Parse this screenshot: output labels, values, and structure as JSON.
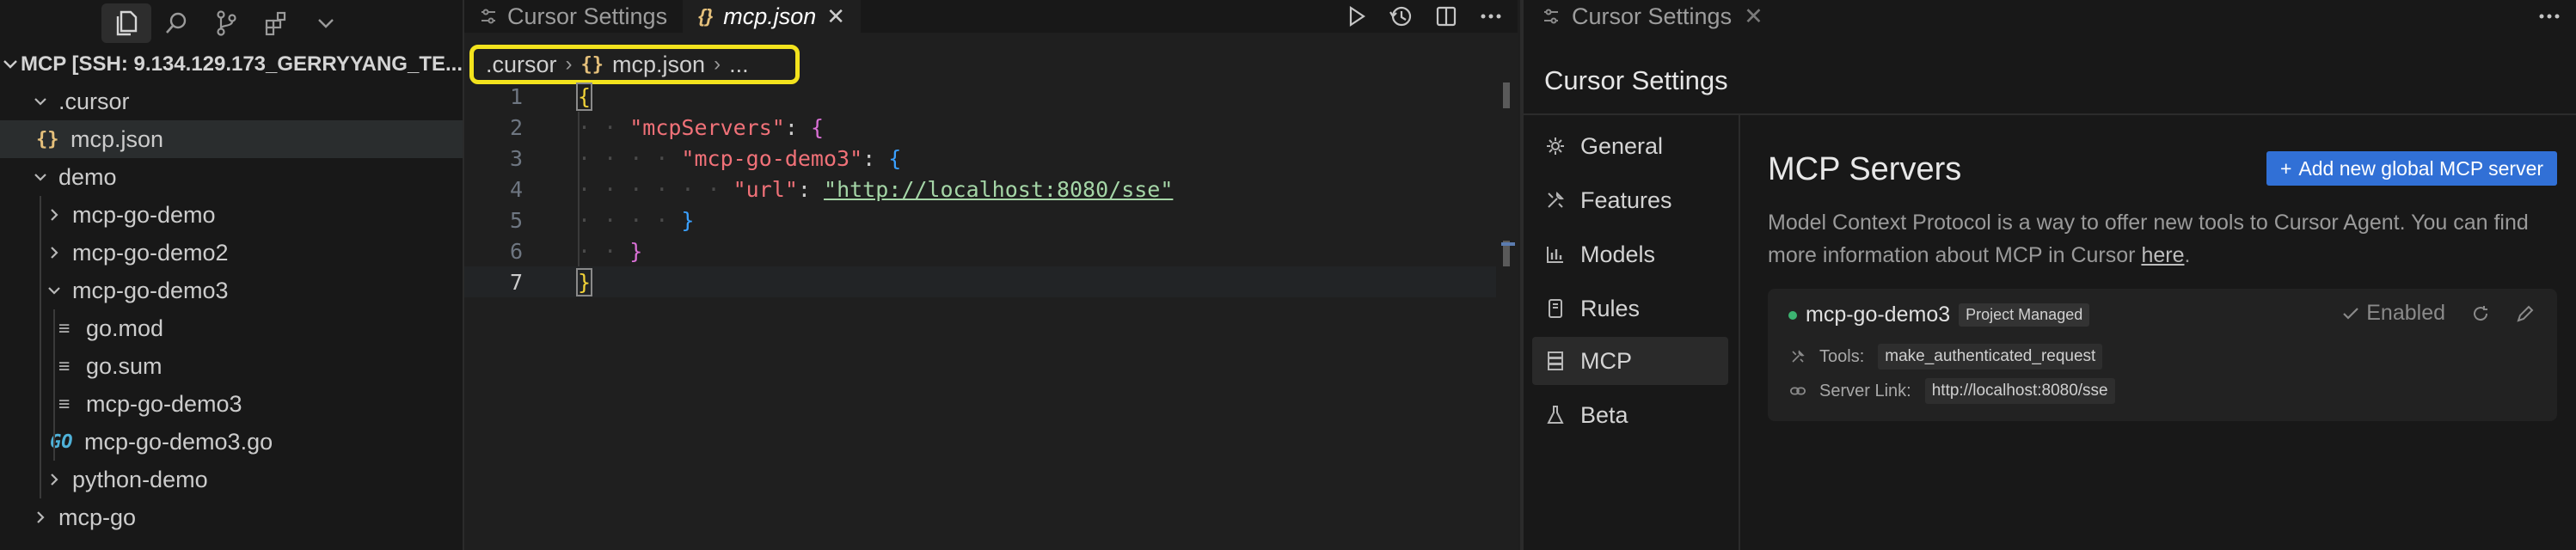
{
  "sidebar": {
    "activity_icons": [
      "files-icon",
      "search-icon",
      "source-control-icon",
      "extensions-icon",
      "chevron-down-icon"
    ],
    "workspace_title": "MCP [SSH: 9.134.129.173_GERRYYANG_TE...",
    "tree": [
      {
        "label": ".cursor",
        "type": "folder",
        "expanded": true
      },
      {
        "label": "mcp.json",
        "type": "json-file",
        "selected": true
      },
      {
        "label": "demo",
        "type": "folder",
        "expanded": true
      },
      {
        "label": "mcp-go-demo",
        "type": "folder",
        "expanded": false
      },
      {
        "label": "mcp-go-demo2",
        "type": "folder",
        "expanded": false
      },
      {
        "label": "mcp-go-demo3",
        "type": "folder",
        "expanded": true
      },
      {
        "label": "go.mod",
        "type": "text-file"
      },
      {
        "label": "go.sum",
        "type": "text-file"
      },
      {
        "label": "mcp-go-demo3",
        "type": "text-file"
      },
      {
        "label": "mcp-go-demo3.go",
        "type": "go-file",
        "icon_text": "GO"
      },
      {
        "label": "python-demo",
        "type": "folder",
        "expanded": false
      },
      {
        "label": "mcp-go",
        "type": "folder",
        "expanded": false
      }
    ]
  },
  "editor": {
    "tabs": [
      {
        "label": "Cursor Settings",
        "icon": "settings-sliders-icon",
        "active": false
      },
      {
        "label": "mcp.json",
        "icon_text": "{}",
        "active": true,
        "close": "✕"
      }
    ],
    "breadcrumbs": {
      "folder": ".cursor",
      "file_icon": "{}",
      "file": "mcp.json",
      "more": "..."
    },
    "lines": [
      {
        "n": "1"
      },
      {
        "n": "2"
      },
      {
        "n": "3"
      },
      {
        "n": "4"
      },
      {
        "n": "5"
      },
      {
        "n": "6"
      },
      {
        "n": "7"
      }
    ],
    "code": {
      "open_brace": "{",
      "key_servers": "\"mcpServers\"",
      "colon": ":",
      "key_demo": "\"mcp-go-demo3\"",
      "key_url": "\"url\"",
      "url_value": "\"http://localhost:8080/sse\"",
      "close_brace": "}"
    },
    "current_line": 7
  },
  "right_panel": {
    "tab_label": "Cursor Settings",
    "tab_close": "✕",
    "title": "Cursor Settings",
    "nav": [
      {
        "label": "General",
        "icon": "gear-icon"
      },
      {
        "label": "Features",
        "icon": "tools-icon"
      },
      {
        "label": "Models",
        "icon": "bar-chart-icon"
      },
      {
        "label": "Rules",
        "icon": "book-icon"
      },
      {
        "label": "MCP",
        "icon": "server-icon",
        "active": true
      },
      {
        "label": "Beta",
        "icon": "flask-icon"
      }
    ],
    "mcp": {
      "heading": "MCP Servers",
      "add_button": "Add new global MCP server",
      "add_button_plus": "+",
      "description_prefix": "Model Context Protocol is a way to offer new tools to Cursor Agent. You can find more information about MCP in Cursor ",
      "description_link": "here",
      "description_suffix": ".",
      "server": {
        "name": "mcp-go-demo3",
        "badge": "Project Managed",
        "status": "Enabled",
        "status_color": "#3cb371",
        "tools_label": "Tools:",
        "tools": [
          "make_authenticated_request"
        ],
        "link_label": "Server Link:",
        "link": "http://localhost:8080/sse"
      }
    }
  }
}
